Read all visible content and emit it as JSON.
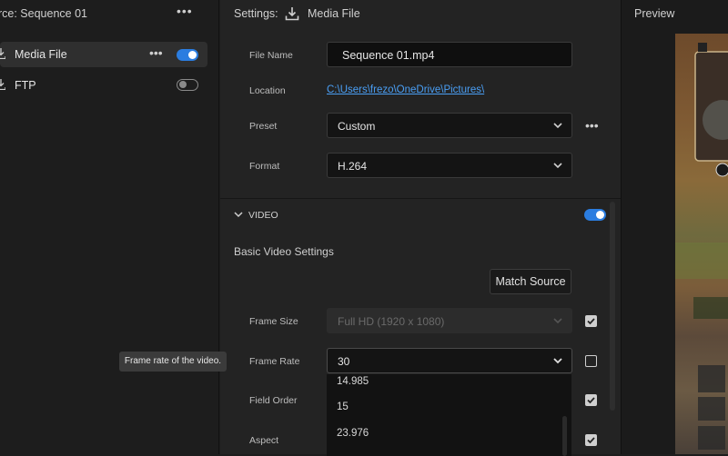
{
  "source": {
    "title": "rce:  Sequence 01"
  },
  "destinations": [
    {
      "label": "Media File",
      "enabled": true,
      "selected": true
    },
    {
      "label": "FTP",
      "enabled": false,
      "selected": false
    }
  ],
  "settings": {
    "title": "Settings:",
    "target": "Media File",
    "file_name_label": "File Name",
    "file_name_value": "Sequence 01.mp4",
    "location_label": "Location",
    "location_value": "C:\\Users\\frezo\\OneDrive\\Pictures\\",
    "preset_label": "Preset",
    "preset_value": "Custom",
    "format_label": "Format",
    "format_value": "H.264"
  },
  "video": {
    "section_label": "VIDEO",
    "enabled": true,
    "basic_title": "Basic Video Settings",
    "match_source_label": "Match Source",
    "frame_size_label": "Frame Size",
    "frame_size_value": "Full HD (1920 x 1080)",
    "frame_rate_label": "Frame Rate",
    "frame_rate_value": "30",
    "frame_rate_options": [
      "14.985",
      "15",
      "23.976"
    ],
    "field_order_label": "Field Order",
    "aspect_label": "Aspect",
    "tooltip": "Frame rate of the video."
  },
  "preview": {
    "title": "Preview"
  },
  "colors": {
    "accent": "#2b7de0",
    "link": "#4a9ff5"
  }
}
